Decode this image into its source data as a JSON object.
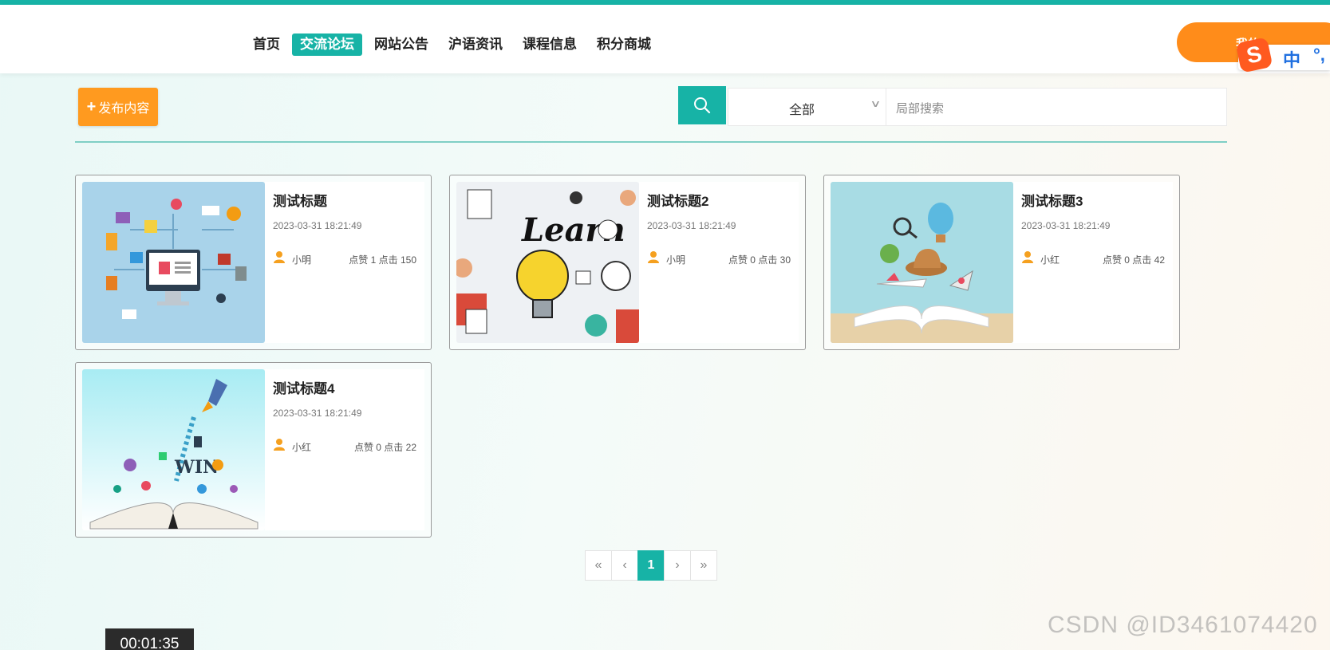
{
  "nav": {
    "items": [
      "首页",
      "交流论坛",
      "网站公告",
      "沪语资讯",
      "课程信息",
      "积分商城"
    ],
    "active_index": 1,
    "my_label": "我的"
  },
  "ime": {
    "logo": "S",
    "mode": "中",
    "punct": "°,"
  },
  "toolbar": {
    "publish_label": "发布内容",
    "filter_value": "全部",
    "search_placeholder": "局部搜索"
  },
  "posts": [
    {
      "title": "测试标题",
      "date": "2023-03-31 18:21:49",
      "author": "小明",
      "stats": "点赞 1 点击 150",
      "image": "ecommerce-illustration"
    },
    {
      "title": "测试标题2",
      "date": "2023-03-31 18:21:49",
      "author": "小明",
      "stats": "点赞 0 点击 30",
      "image": "learn-lightbulb-illustration"
    },
    {
      "title": "测试标题3",
      "date": "2023-03-31 18:21:49",
      "author": "小红",
      "stats": "点赞 0 点击 42",
      "image": "open-book-travel-illustration"
    },
    {
      "title": "测试标题4",
      "date": "2023-03-31 18:21:49",
      "author": "小红",
      "stats": "点赞 0 点击 22",
      "image": "book-rocket-win-illustration"
    }
  ],
  "pagination": {
    "first": "«",
    "prev": "‹",
    "current": "1",
    "next": "›",
    "last": "»"
  },
  "overlay": {
    "timer": "00:01:35",
    "watermark": "CSDN @ID3461074420"
  },
  "colors": {
    "accent": "#17b3a6",
    "orange": "#ff9a1f"
  }
}
